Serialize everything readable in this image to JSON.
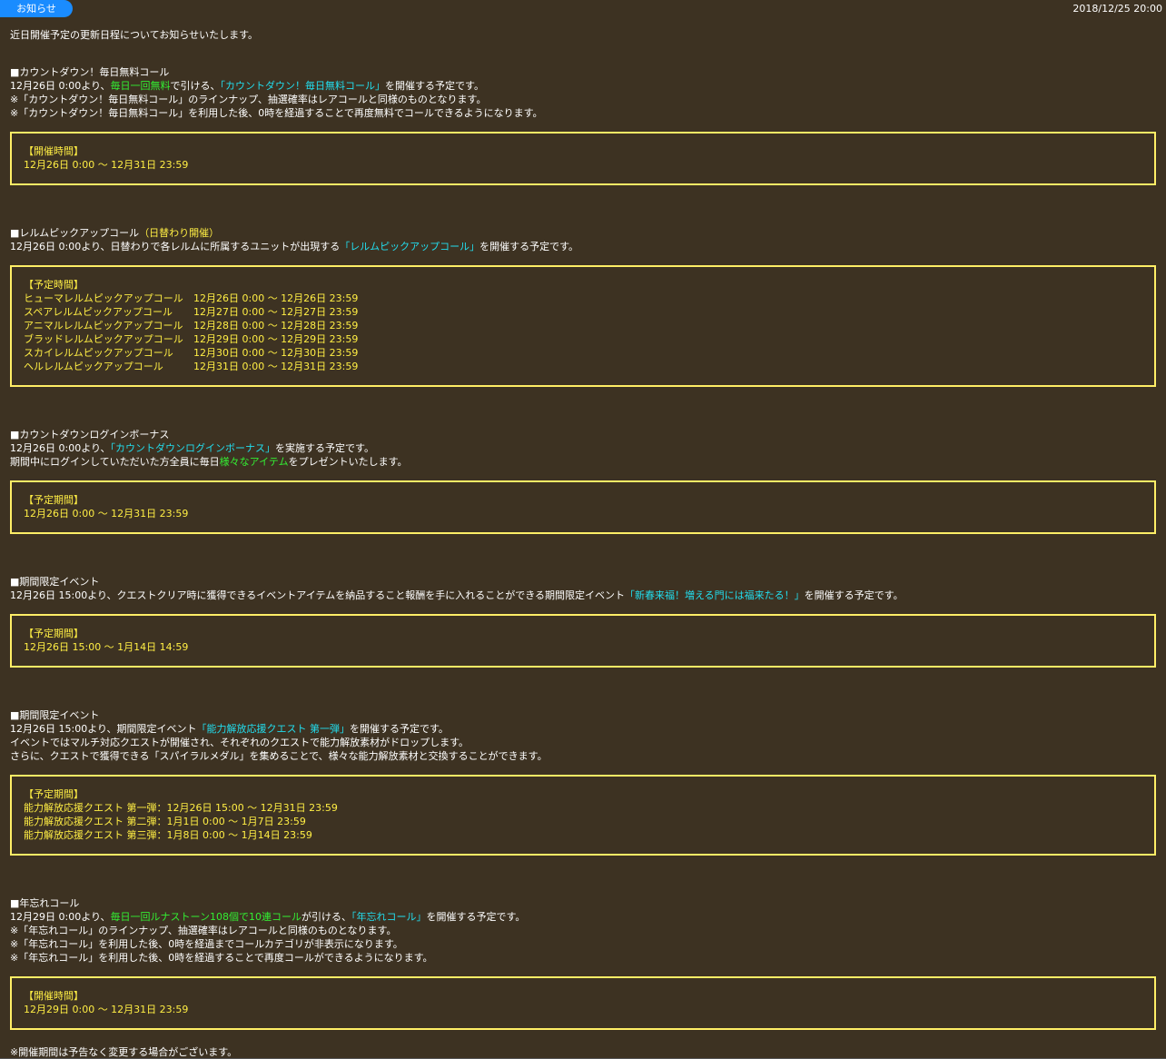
{
  "header": {
    "tag": "お知らせ",
    "datetime": "2018/12/25 20:00"
  },
  "intro": "近日開催予定の更新日程についてお知らせいたします。",
  "s1": {
    "title": "■カウントダウン！毎日無料コール",
    "l1a": "12月26日 0:00より、",
    "l1b": "毎日一回無料",
    "l1c": "で引ける、",
    "l1d": "「カウントダウン！毎日無料コール」",
    "l1e": "を開催する予定です。",
    "l2": "※「カウントダウン！毎日無料コール」のラインナップ、抽選確率はレアコールと同様のものとなります。",
    "l3": "※「カウントダウン！毎日無料コール」を利用した後、0時を経過することで再度無料でコールできるようになります。",
    "box_title": "【開催時間】",
    "box_line": "12月26日 0:00 ～ 12月31日 23:59"
  },
  "s2": {
    "title_a": "■レルムピックアップコール",
    "title_b": "（日替わり開催）",
    "l1a": "12月26日 0:00より、日替わりで各レルムに所属するユニットが出現する",
    "l1b": "「レルムピックアップコール」",
    "l1c": "を開催する予定です。",
    "box_title": "【予定時間】",
    "rows": [
      {
        "name": "ヒューマレルムピックアップコール",
        "time": "12月26日 0:00 ～ 12月26日 23:59"
      },
      {
        "name": "スペアレルムピックアップコール",
        "time": "12月27日 0:00 ～ 12月27日 23:59"
      },
      {
        "name": "アニマルレルムピックアップコール",
        "time": "12月28日 0:00 ～ 12月28日 23:59"
      },
      {
        "name": "ブラッドレルムピックアップコール",
        "time": "12月29日 0:00 ～ 12月29日 23:59"
      },
      {
        "name": "スカイレルムピックアップコール",
        "time": "12月30日 0:00 ～ 12月30日 23:59"
      },
      {
        "name": "ヘルレルムピックアップコール",
        "time": "12月31日 0:00 ～ 12月31日 23:59"
      }
    ]
  },
  "s3": {
    "title": "■カウントダウンログインボーナス",
    "l1a": "12月26日 0:00より、",
    "l1b": "「カウントダウンログインボーナス」",
    "l1c": "を実施する予定です。",
    "l2a": "期間中にログインしていただいた方全員に毎日",
    "l2b": "様々なアイテム",
    "l2c": "をプレゼントいたします。",
    "box_title": "【予定期間】",
    "box_line": "12月26日 0:00 ～ 12月31日 23:59"
  },
  "s4": {
    "title": "■期間限定イベント",
    "l1a": "12月26日 15:00より、クエストクリア時に獲得できるイベントアイテムを納品すること報酬を手に入れることができる期間限定イベント",
    "l1b": "「新春来福！増える門には福来たる！」",
    "l1c": "を開催する予定です。",
    "box_title": "【予定期間】",
    "box_line": "12月26日 15:00 ～ 1月14日 14:59"
  },
  "s5": {
    "title": "■期間限定イベント",
    "l1a": "12月26日 15:00より、期間限定イベント",
    "l1b": "「能力解放応援クエスト 第一弾」",
    "l1c": "を開催する予定です。",
    "l2": "イベントではマルチ対応クエストが開催され、それぞれのクエストで能力解放素材がドロップします。",
    "l3": "さらに、クエストで獲得できる「スパイラルメダル」を集めることで、様々な能力解放素材と交換することができます。",
    "box_title": "【予定期間】",
    "box_lines": [
      "能力解放応援クエスト 第一弾：12月26日 15:00 ～ 12月31日 23:59",
      "能力解放応援クエスト 第二弾：1月1日 0:00 ～ 1月7日 23:59",
      "能力解放応援クエスト 第三弾：1月8日 0:00 ～ 1月14日 23:59"
    ]
  },
  "s6": {
    "title": "■年忘れコール",
    "l1a": "12月29日 0:00より、",
    "l1b": "毎日一回ルナストーン108個で10連コール",
    "l1c": "が引ける、",
    "l1d": "「年忘れコール」",
    "l1e": "を開催する予定です。",
    "l2": "※「年忘れコール」のラインナップ、抽選確率はレアコールと同様のものとなります。",
    "l3": "※「年忘れコール」を利用した後、0時を経過までコールカテゴリが非表示になります。",
    "l4": "※「年忘れコール」を利用した後、0時を経過することで再度コールができるようになります。",
    "box_title": "【開催時間】",
    "box_line": "12月29日 0:00 ～ 12月31日 23:59"
  },
  "footer": "※開催期間は予告なく変更する場合がございます。"
}
